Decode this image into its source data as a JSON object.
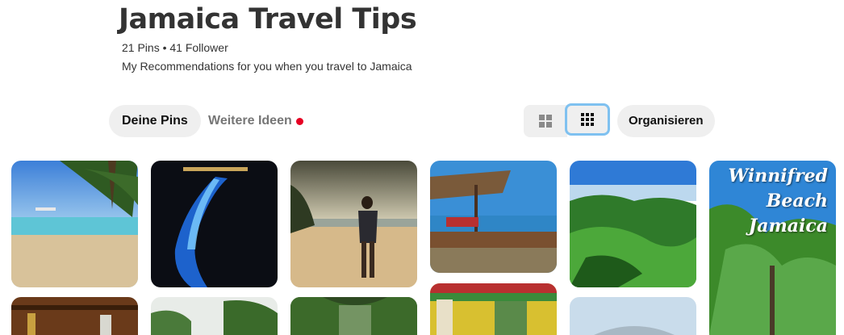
{
  "board": {
    "title": "Jamaica Travel Tips",
    "stats": "21 Pins • 41 Follower",
    "description": "My Recommendations for you when you travel to Jamaica"
  },
  "tabs": {
    "pins_label": "Deine Pins",
    "ideas_label": "Weitere Ideen"
  },
  "toolbar": {
    "view_default_icon": "grid-2x2-icon",
    "view_compact_icon": "grid-3x3-icon",
    "organize_label": "Organisieren"
  },
  "colors": {
    "accent_red": "#e60023",
    "focus_ring": "#7fc1f0",
    "chip_bg": "#efefef"
  },
  "pins": {
    "winnifred_line1": "Winnifred",
    "winnifred_line2": "Beach",
    "winnifred_line3": "Jamaica"
  }
}
